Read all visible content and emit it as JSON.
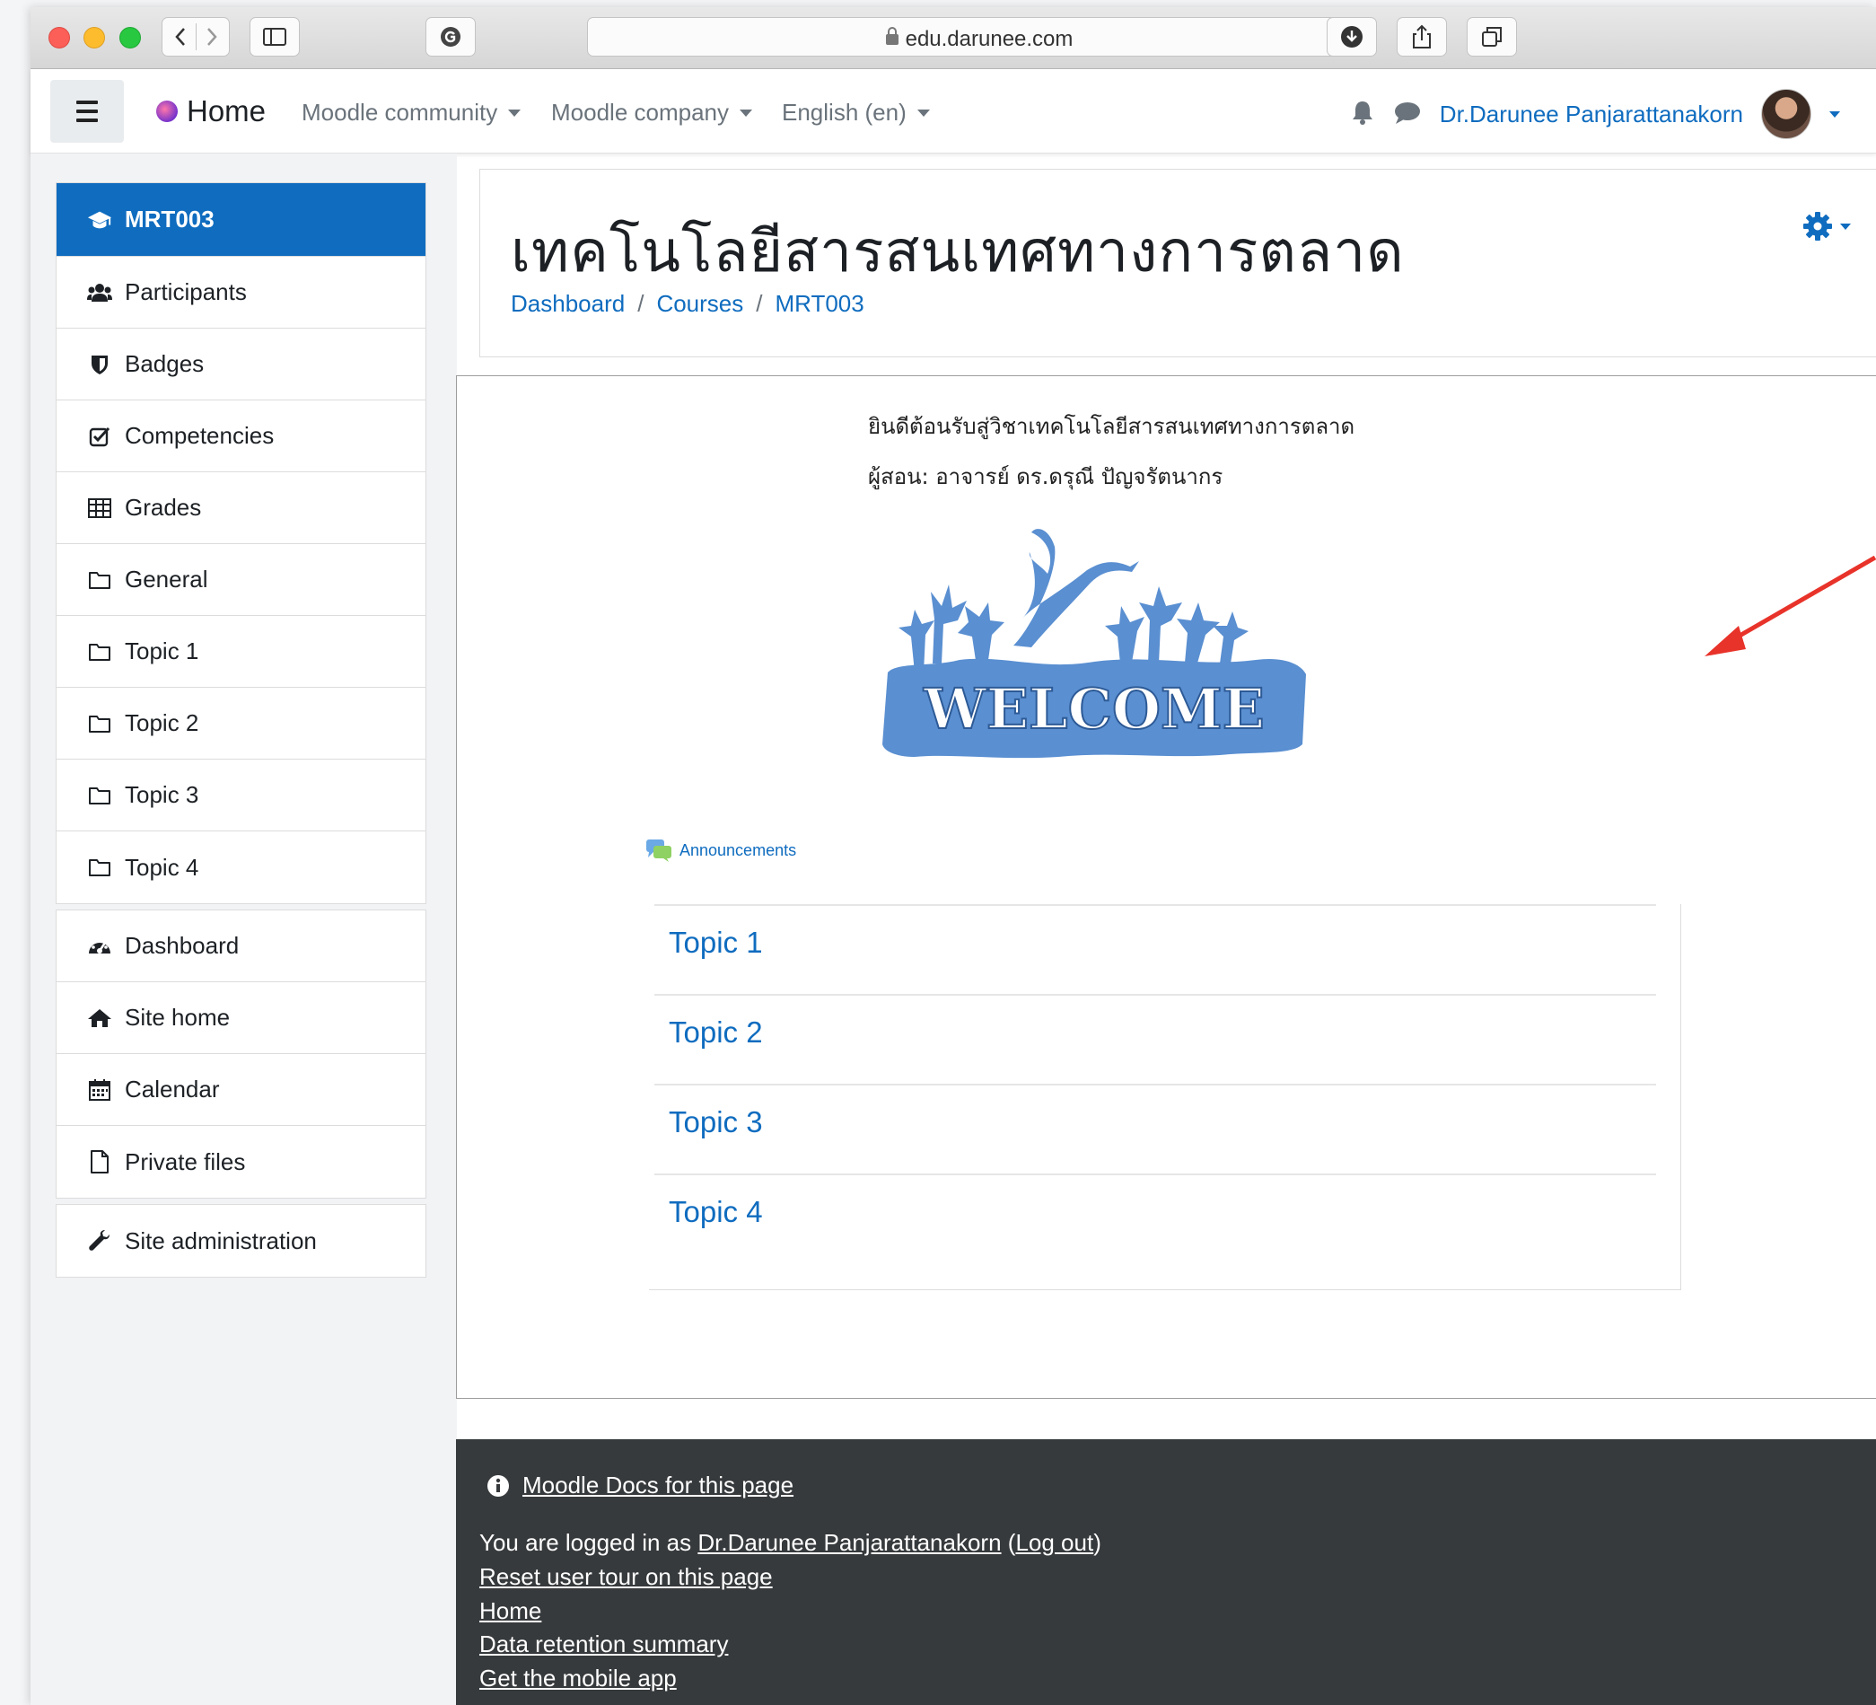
{
  "browser": {
    "url": "edu.darunee.com"
  },
  "navbar": {
    "brand": "Home",
    "menus": [
      "Moodle community",
      "Moodle company",
      "English (en)"
    ],
    "user_name": "Dr.Darunee Panjarattanakorn"
  },
  "sidebar": {
    "group1": [
      {
        "label": "MRT003",
        "icon": "graduation-cap-icon",
        "active": true
      },
      {
        "label": "Participants",
        "icon": "users-icon"
      },
      {
        "label": "Badges",
        "icon": "shield-icon"
      },
      {
        "label": "Competencies",
        "icon": "check-square-icon"
      },
      {
        "label": "Grades",
        "icon": "table-icon"
      },
      {
        "label": "General",
        "icon": "folder-icon"
      },
      {
        "label": "Topic 1",
        "icon": "folder-icon"
      },
      {
        "label": "Topic 2",
        "icon": "folder-icon"
      },
      {
        "label": "Topic 3",
        "icon": "folder-icon"
      },
      {
        "label": "Topic 4",
        "icon": "folder-icon"
      }
    ],
    "group2": [
      {
        "label": "Dashboard",
        "icon": "dashboard-icon"
      },
      {
        "label": "Site home",
        "icon": "home-icon"
      },
      {
        "label": "Calendar",
        "icon": "calendar-icon"
      },
      {
        "label": "Private files",
        "icon": "file-icon"
      }
    ],
    "group3": [
      {
        "label": "Site administration",
        "icon": "wrench-icon"
      }
    ]
  },
  "header": {
    "title": "เทคโนโลยีสารสนเทศทางการตลาด",
    "breadcrumb": [
      "Dashboard",
      "Courses",
      "MRT003"
    ]
  },
  "content": {
    "welcome_text": "ยินดีต้อนรับสู่วิชาเทคโนโลยีสารสนเทศทางการตลาด",
    "instructor_text": "ผู้สอน: อาจารย์ ดร.ดรุณี ปัญจรัตนากร",
    "welcome_image_text": "WELCOME",
    "announcements": "Announcements",
    "topics": [
      "Topic 1",
      "Topic 2",
      "Topic 3",
      "Topic 4"
    ]
  },
  "footer": {
    "docs_link": "Moodle Docs for this page",
    "logged_in_prefix": "You are logged in as ",
    "logged_in_user": "Dr.Darunee Panjarattanakorn",
    "logout_open": " (",
    "logout": "Log out",
    "logout_close": ")",
    "links": [
      "Reset user tour on this page",
      "Home",
      "Data retention summary",
      "Get the mobile app"
    ]
  },
  "colors": {
    "primary": "#0f6cbf",
    "footer_bg": "#373a3c",
    "annotation_arrow": "#e8332a"
  }
}
